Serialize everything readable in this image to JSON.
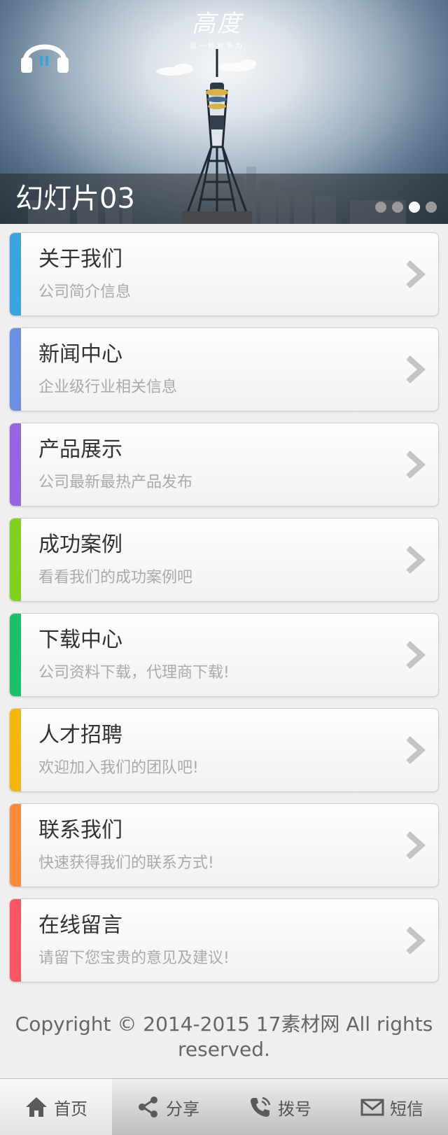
{
  "banner": {
    "caption": "幻灯片03",
    "brand_title": "高度",
    "brand_subtitle": "是一种竞争力",
    "dots_count": 4,
    "active_dot": 3
  },
  "menu": [
    {
      "title": "关于我们",
      "subtitle": "公司简介信息",
      "color": "#3aa4e0"
    },
    {
      "title": "新闻中心",
      "subtitle": "企业级行业相关信息",
      "color": "#6b8fe3"
    },
    {
      "title": "产品展示",
      "subtitle": "公司最新最热产品发布",
      "color": "#9466e0"
    },
    {
      "title": "成功案例",
      "subtitle": "看看我们的成功案例吧",
      "color": "#7ed321"
    },
    {
      "title": "下载中心",
      "subtitle": "公司资料下载，代理商下载!",
      "color": "#19c266"
    },
    {
      "title": "人才招聘",
      "subtitle": "欢迎加入我们的团队吧!",
      "color": "#f5b60e"
    },
    {
      "title": "联系我们",
      "subtitle": "快速获得我们的联系方式!",
      "color": "#ff8b3d"
    },
    {
      "title": "在线留言",
      "subtitle": "请留下您宝贵的意见及建议!",
      "color": "#ff5564"
    }
  ],
  "footer": {
    "copyright": "Copyright © 2014-2015 17素材网 All rights reserved."
  },
  "nav": [
    {
      "label": "首页",
      "icon": "home-icon"
    },
    {
      "label": "分享",
      "icon": "share-icon"
    },
    {
      "label": "拨号",
      "icon": "phone-icon"
    },
    {
      "label": "短信",
      "icon": "mail-icon"
    }
  ]
}
